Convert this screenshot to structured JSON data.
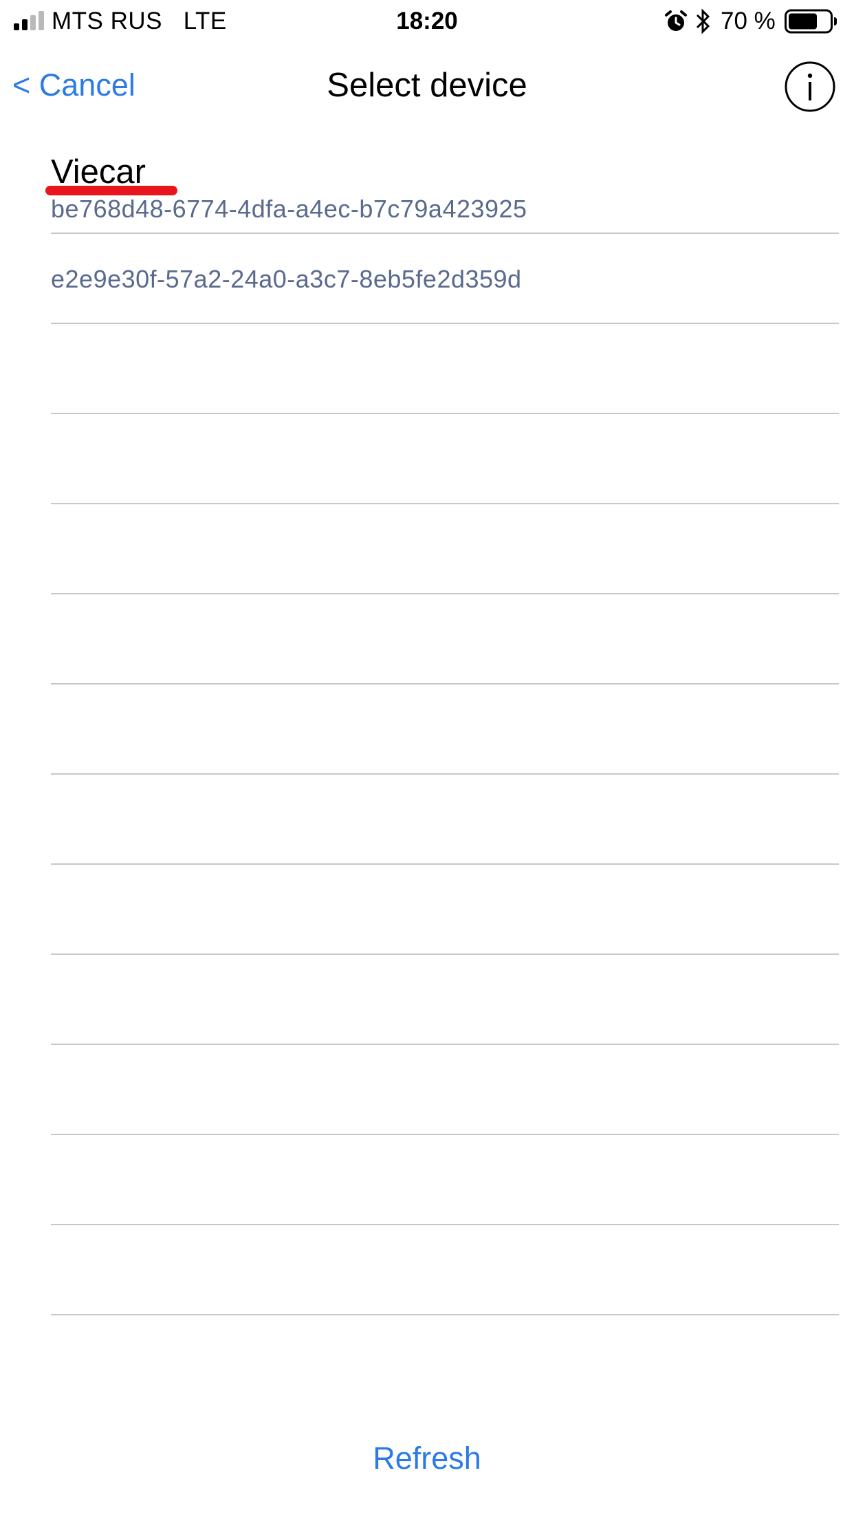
{
  "status_bar": {
    "carrier": "MTS RUS",
    "network": "LTE",
    "time": "18:20",
    "battery_percent": "70 %",
    "battery_level": 0.7,
    "signal_bars": 2,
    "icons": [
      "signal-icon",
      "alarm-icon",
      "bluetooth-icon",
      "battery-icon"
    ]
  },
  "nav": {
    "cancel_label": "< Cancel",
    "title": "Select device",
    "info_icon": "info-icon"
  },
  "devices": [
    {
      "name": "Viecar",
      "uuid": "be768d48-6774-4dfa-a4ec-b7c79a423925"
    },
    {
      "name": "",
      "uuid": "e2e9e30f-57a2-24a0-a3c7-8eb5fe2d359d"
    }
  ],
  "footer": {
    "refresh_label": "Refresh"
  },
  "colors": {
    "accent": "#2c7be5",
    "uuid_text": "#5a6a8e",
    "separator": "#c8c8cc",
    "annotation": "#e8151c"
  }
}
